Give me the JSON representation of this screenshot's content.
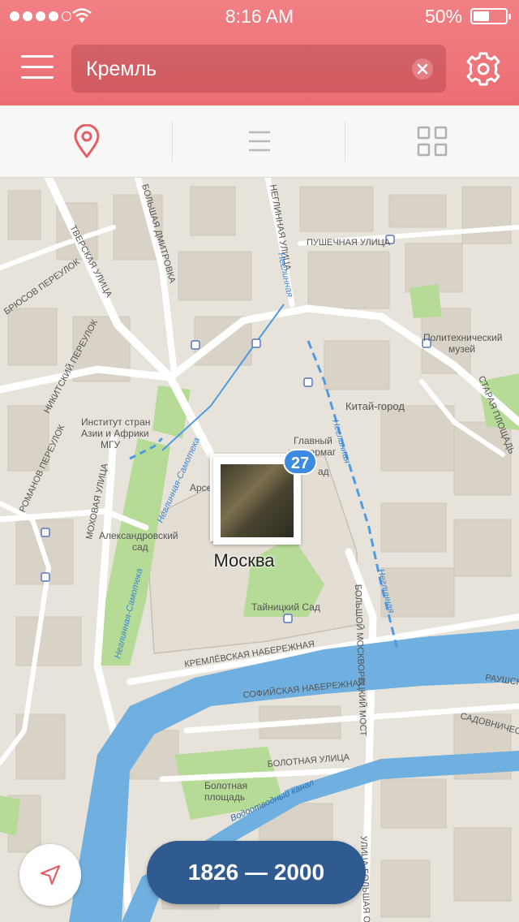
{
  "status_bar": {
    "time": "8:16 AM",
    "battery_percent": "50%",
    "battery_level": 0.5,
    "signal_bars": 4,
    "signal_max": 5
  },
  "header": {
    "search_value": "Кремль",
    "menu_icon": "hamburger-menu-icon",
    "settings_icon": "gear-icon",
    "clear_icon": "clear-x-icon"
  },
  "toolbar": {
    "tabs": [
      {
        "icon": "map-pin-icon",
        "active": true
      },
      {
        "icon": "list-icon",
        "active": false
      },
      {
        "icon": "grid-icon",
        "active": false
      }
    ]
  },
  "colors": {
    "header": "#ec6e73",
    "accent": "#e85d64",
    "water": "#6fb0e0",
    "park": "#aed68b",
    "badge": "#3d8be0",
    "range_button": "#2f5b91"
  },
  "map": {
    "cluster_count": "27",
    "city_label": "Москва",
    "labels": {
      "tverskaya": "ТВЕРСКАЯ УЛИЦА",
      "b_dmitrovka": "БОЛЬШАЯ ДМИТРОВКА",
      "neglinnaya_ul": "НЕГЛИННАЯ УЛИЦА",
      "pushechnaya": "ПУШЕЧНАЯ УЛИЦА",
      "brusov": "БРЮСОВ ПЕРЕУЛОК",
      "nikitsky": "НИКИТСКИЙ ПЕРЕУЛОК",
      "romanov": "РОМАНОВ ПЕРЕУЛОК",
      "mokhovaya": "МОХОВАЯ УЛИЦА",
      "institute_1": "Институт стран",
      "institute_2": "Азии и Африки",
      "institute_3": "МГУ",
      "polytech_1": "Политехнический",
      "polytech_2": "музей",
      "kitay_gorod": "Китай-город",
      "staraya": "СТАРАЯ ПЛОЩАДЬ",
      "main_dept_1": "Главный",
      "main_dept_2": "универмаг",
      "main_dept_3": "ад",
      "arsenal": "Арсена",
      "alex_garden_1": "Александровский",
      "alex_garden_2": "сад",
      "taynitsky": "Тайницкий Сад",
      "kremlin_emb": "КРЕМЛЁВСКАЯ НАБЕРЕЖНАЯ",
      "sofia_emb": "СОФИЙСКАЯ НАБЕРЕЖНАЯ",
      "bolotnaya_st": "БОЛОТНАЯ УЛИЦА",
      "bolotnaya_sq_1": "Болотная",
      "bolotnaya_sq_2": "площадь",
      "moskvoretsky": "БОЛЬШОЙ МОСКВОРЕЦКИЙ МОСТ",
      "ordynka": "УЛИЦА БОЛЬШАЯ ОРДЫНКА",
      "raush": "РАУШСК",
      "sadovnicheskaya": "САДОВНИЧЕСК",
      "neglinnaya_river_1": "Неглинная",
      "neglinnaya_river_2": "Неглинная",
      "neglinnaya_river_3": "Неглинная",
      "samoteka_1": "Неглинная-Самотека",
      "samoteka_2": "Неглинная-Самотека",
      "vodootvodny": "Водоотводный канал"
    }
  },
  "controls": {
    "locate_icon": "location-arrow-icon",
    "year_range": "1826 — 2000"
  }
}
